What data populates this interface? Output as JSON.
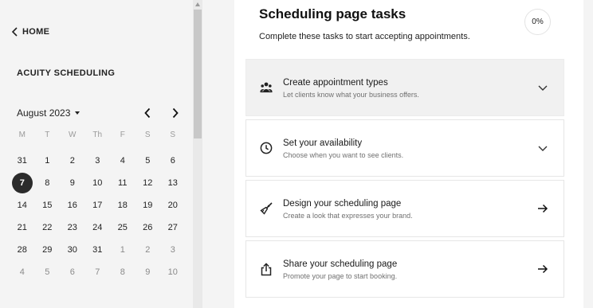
{
  "sidebar": {
    "home_label": "HOME",
    "brand_title": "ACUITY SCHEDULING",
    "calendar": {
      "month_label": "August 2023",
      "weekdays": [
        "M",
        "T",
        "W",
        "Th",
        "F",
        "S",
        "S"
      ],
      "weeks": [
        [
          {
            "d": "31",
            "muted": false
          },
          {
            "d": "1",
            "muted": false
          },
          {
            "d": "2",
            "muted": false
          },
          {
            "d": "3",
            "muted": false
          },
          {
            "d": "4",
            "muted": false
          },
          {
            "d": "5",
            "muted": false
          },
          {
            "d": "6",
            "muted": false
          }
        ],
        [
          {
            "d": "7",
            "muted": false,
            "selected": true
          },
          {
            "d": "8",
            "muted": false
          },
          {
            "d": "9",
            "muted": false
          },
          {
            "d": "10",
            "muted": false
          },
          {
            "d": "11",
            "muted": false
          },
          {
            "d": "12",
            "muted": false
          },
          {
            "d": "13",
            "muted": false
          }
        ],
        [
          {
            "d": "14",
            "muted": false
          },
          {
            "d": "15",
            "muted": false
          },
          {
            "d": "16",
            "muted": false
          },
          {
            "d": "17",
            "muted": false
          },
          {
            "d": "18",
            "muted": false
          },
          {
            "d": "19",
            "muted": false
          },
          {
            "d": "20",
            "muted": false
          }
        ],
        [
          {
            "d": "21",
            "muted": false
          },
          {
            "d": "22",
            "muted": false
          },
          {
            "d": "23",
            "muted": false
          },
          {
            "d": "24",
            "muted": false
          },
          {
            "d": "25",
            "muted": false
          },
          {
            "d": "26",
            "muted": false
          },
          {
            "d": "27",
            "muted": false
          }
        ],
        [
          {
            "d": "28",
            "muted": false
          },
          {
            "d": "29",
            "muted": false
          },
          {
            "d": "30",
            "muted": false
          },
          {
            "d": "31",
            "muted": false
          },
          {
            "d": "1",
            "muted": true
          },
          {
            "d": "2",
            "muted": true
          },
          {
            "d": "3",
            "muted": true
          }
        ],
        [
          {
            "d": "4",
            "muted": true
          },
          {
            "d": "5",
            "muted": true
          },
          {
            "d": "6",
            "muted": true
          },
          {
            "d": "7",
            "muted": true
          },
          {
            "d": "8",
            "muted": true
          },
          {
            "d": "9",
            "muted": true
          },
          {
            "d": "10",
            "muted": true
          }
        ]
      ]
    }
  },
  "main": {
    "title": "Scheduling page tasks",
    "subtitle": "Complete these tasks to start accepting appointments.",
    "progress": "0%",
    "tasks": [
      {
        "title": "Create appointment types",
        "desc": "Let clients know what your business offers.",
        "icon": "people-icon",
        "action": "chevron-down-icon",
        "active": true
      },
      {
        "title": "Set your availability",
        "desc": "Choose when you want to see clients.",
        "icon": "clock-icon",
        "action": "chevron-down-icon",
        "active": false
      },
      {
        "title": "Design your scheduling page",
        "desc": "Create a look that expresses your brand.",
        "icon": "brush-icon",
        "action": "arrow-right-icon",
        "active": false
      },
      {
        "title": "Share your scheduling page",
        "desc": "Promote your page to start booking.",
        "icon": "share-icon",
        "action": "arrow-right-icon",
        "active": false
      }
    ]
  },
  "colors": {
    "selected_day_bg": "#2b2b2b",
    "sidebar_bg": "#f4f4f4",
    "active_task_bg": "#f1f1f1"
  }
}
